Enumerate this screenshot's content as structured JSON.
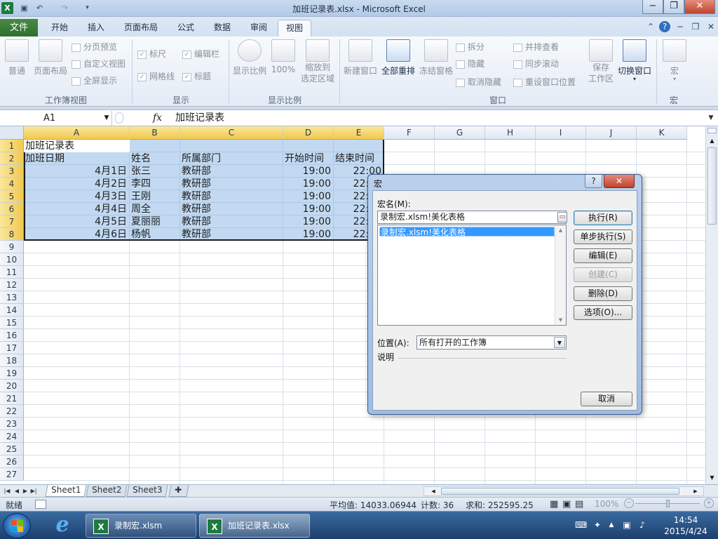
{
  "window": {
    "title": "加班记录表.xlsx - Microsoft Excel",
    "min_icon": "minimize-icon",
    "max_icon": "restore-icon",
    "close_icon": "close-icon"
  },
  "ribbon_tabs": {
    "file": "文件",
    "items": [
      "开始",
      "插入",
      "页面布局",
      "公式",
      "数据",
      "审阅",
      "视图"
    ],
    "active": "视图"
  },
  "ribbon": {
    "groups": {
      "workbook_views": {
        "label": "工作簿视图",
        "normal": "普通",
        "page_layout": "页面布局",
        "page_break": "分页预览",
        "custom_views": "自定义视图",
        "full_screen": "全屏显示"
      },
      "show": {
        "label": "显示",
        "ruler": "标尺",
        "formula_bar": "编辑栏",
        "gridlines": "网格线",
        "headings": "标题"
      },
      "zoom": {
        "label": "显示比例",
        "zoom": "显示比例",
        "zoom100": "100%",
        "zoom_sel_1": "缩放到",
        "zoom_sel_2": "选定区域"
      },
      "window": {
        "label": "窗口",
        "new_window": "新建窗口",
        "arrange_all": "全部重排",
        "freeze_panes": "冻结窗格",
        "split": "拆分",
        "hide": "隐藏",
        "unhide": "取消隐藏",
        "side_by_side": "并排查看",
        "sync_scroll": "同步滚动",
        "reset_position": "重设窗口位置",
        "save_ws_1": "保存",
        "save_ws_2": "工作区",
        "switch_windows": "切换窗口"
      },
      "macros": {
        "label": "宏",
        "macros": "宏"
      }
    }
  },
  "formula_bar": {
    "name_box": "A1",
    "fx": "fx",
    "content": "加班记录表"
  },
  "sheet": {
    "columns": [
      "A",
      "B",
      "C",
      "D",
      "E",
      "F",
      "G",
      "H",
      "I",
      "J",
      "K"
    ],
    "rows": [
      "1",
      "2",
      "3",
      "4",
      "5",
      "6",
      "7",
      "8",
      "9",
      "10",
      "11",
      "12",
      "13",
      "14",
      "15",
      "16",
      "17",
      "18",
      "19",
      "20",
      "21",
      "22",
      "23",
      "24",
      "25",
      "26",
      "27"
    ],
    "title": "加班记录表",
    "headers": [
      "加班日期",
      "姓名",
      "所属部门",
      "开始时间",
      "结束时间"
    ],
    "data": [
      [
        "4月1日",
        "张三",
        "教研部",
        "19:00",
        "22:00"
      ],
      [
        "4月2日",
        "李四",
        "教研部",
        "19:00",
        "22:00"
      ],
      [
        "4月3日",
        "王刚",
        "教研部",
        "19:00",
        "22:00"
      ],
      [
        "4月4日",
        "周全",
        "教研部",
        "19:00",
        "22:00"
      ],
      [
        "4月5日",
        "夏丽丽",
        "教研部",
        "19:00",
        "22:00"
      ],
      [
        "4月6日",
        "杨帆",
        "教研部",
        "19:00",
        "22:00"
      ]
    ]
  },
  "sheet_tabs": [
    "Sheet1",
    "Sheet2",
    "Sheet3"
  ],
  "status_bar": {
    "ready": "就绪",
    "average": "平均值: 14033.06944",
    "count": "计数: 36",
    "sum": "求和: 252595.25",
    "zoom": "100%"
  },
  "dialog": {
    "title": "宏",
    "help": "?",
    "macro_name_label": "宏名(M):",
    "macro_name_value": "录制宏.xlsm!美化表格",
    "list_items": [
      "录制宏.xlsm!美化表格"
    ],
    "location_label": "位置(A):",
    "location_value": "所有打开的工作簿",
    "description_label": "说明",
    "buttons": {
      "run": "执行(R)",
      "step_into": "单步执行(S)",
      "edit": "编辑(E)",
      "create": "创建(C)",
      "delete": "删除(D)",
      "options": "选项(O)...",
      "cancel": "取消"
    }
  },
  "taskbar": {
    "items": [
      "录制宏.xlsm",
      "加班记录表.xlsx"
    ],
    "time": "14:54",
    "date": "2015/4/24"
  },
  "colors": {
    "accent": "#2f6e2c",
    "selection": "#9cc2ea",
    "dialog_frame": "#a9c4e6"
  }
}
